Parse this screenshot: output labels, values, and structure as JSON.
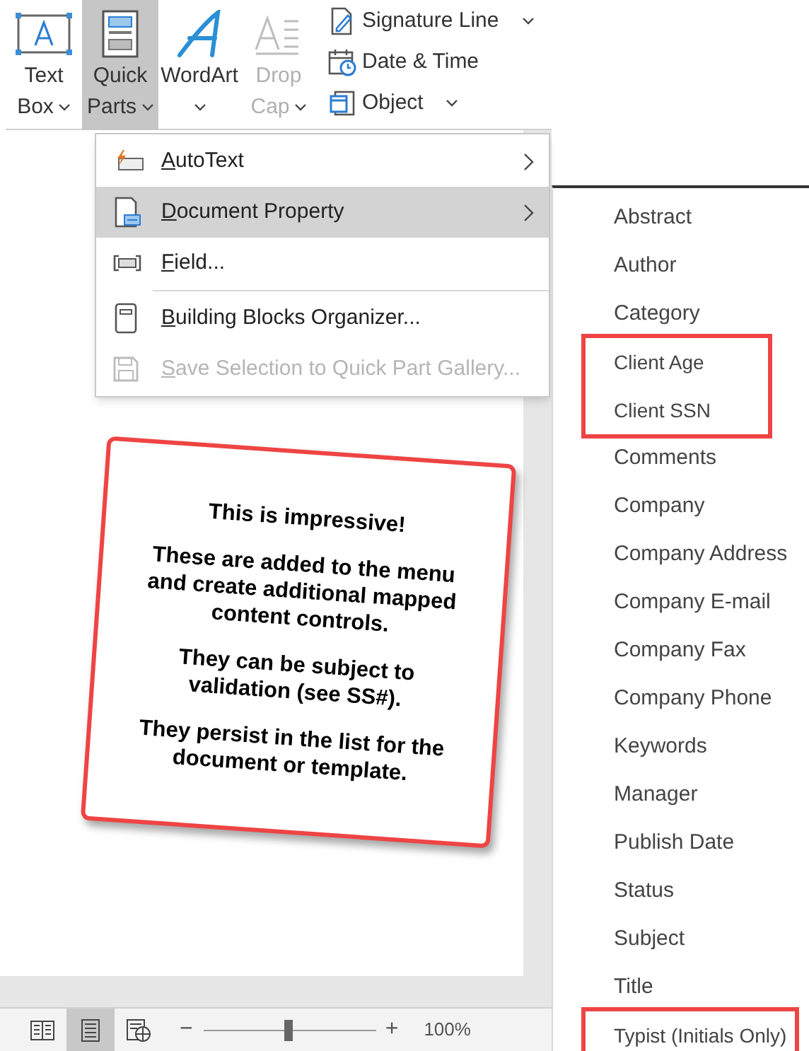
{
  "ribbon": {
    "large_buttons": [
      {
        "kind": "textbox",
        "lines": [
          "Text",
          "Box"
        ],
        "caret": true,
        "selected": false,
        "disabled": false
      },
      {
        "kind": "quickparts",
        "lines": [
          "Quick",
          "Parts"
        ],
        "caret": true,
        "selected": true,
        "disabled": false
      },
      {
        "kind": "wordart",
        "lines": [
          "WordArt"
        ],
        "caret": true,
        "selected": false,
        "disabled": false
      },
      {
        "kind": "dropcap",
        "lines": [
          "Drop",
          "Cap"
        ],
        "caret": true,
        "selected": false,
        "disabled": true
      }
    ],
    "small_buttons": [
      {
        "kind": "signature",
        "label": "Signature Line",
        "caret": true
      },
      {
        "kind": "datetime",
        "label": "Date & Time",
        "caret": false
      },
      {
        "kind": "object",
        "label": "Object",
        "caret": true
      }
    ]
  },
  "menu": {
    "items": [
      {
        "kind": "autotext",
        "label": "AutoText",
        "submenu": true,
        "selected": false,
        "disabled": false
      },
      {
        "kind": "docprop",
        "label": "Document Property",
        "submenu": true,
        "selected": true,
        "disabled": false
      },
      {
        "kind": "field",
        "label": "Field...",
        "submenu": false,
        "selected": false,
        "disabled": false
      },
      {
        "kind": "separator"
      },
      {
        "kind": "organizer",
        "label": "Building Blocks Organizer...",
        "submenu": false,
        "selected": false,
        "disabled": false
      },
      {
        "kind": "save",
        "label": "Save Selection to Quick Part Gallery...",
        "submenu": false,
        "selected": false,
        "disabled": true
      }
    ]
  },
  "submenu": {
    "items": [
      {
        "label": "Abstract",
        "annotated": false
      },
      {
        "label": "Author",
        "annotated": false
      },
      {
        "label": "Category",
        "annotated": false
      },
      {
        "label": "Client Age",
        "annotated": true
      },
      {
        "label": "Client SSN",
        "annotated": true
      },
      {
        "label": "Comments",
        "annotated": false
      },
      {
        "label": "Company",
        "annotated": false
      },
      {
        "label": "Company Address",
        "annotated": false
      },
      {
        "label": "Company E-mail",
        "annotated": false
      },
      {
        "label": "Company Fax",
        "annotated": false
      },
      {
        "label": "Company Phone",
        "annotated": false
      },
      {
        "label": "Keywords",
        "annotated": false
      },
      {
        "label": "Manager",
        "annotated": false
      },
      {
        "label": "Publish Date",
        "annotated": false
      },
      {
        "label": "Status",
        "annotated": false
      },
      {
        "label": "Subject",
        "annotated": false
      },
      {
        "label": "Title",
        "annotated": false
      },
      {
        "label": "Typist (Initials Only)",
        "annotated": true
      }
    ]
  },
  "callout": {
    "paragraphs": [
      "This is impressive!",
      "These are added to the menu and create additional mapped content controls.",
      "They can be subject to validation (see SS#).",
      "They persist in the list for the document or template."
    ]
  },
  "status_bar": {
    "views": [
      {
        "kind": "read",
        "selected": false
      },
      {
        "kind": "print",
        "selected": true
      },
      {
        "kind": "web",
        "selected": false
      }
    ],
    "zoom": {
      "level": 0.49,
      "minus": "−",
      "plus": "+",
      "reading": "100%"
    }
  }
}
